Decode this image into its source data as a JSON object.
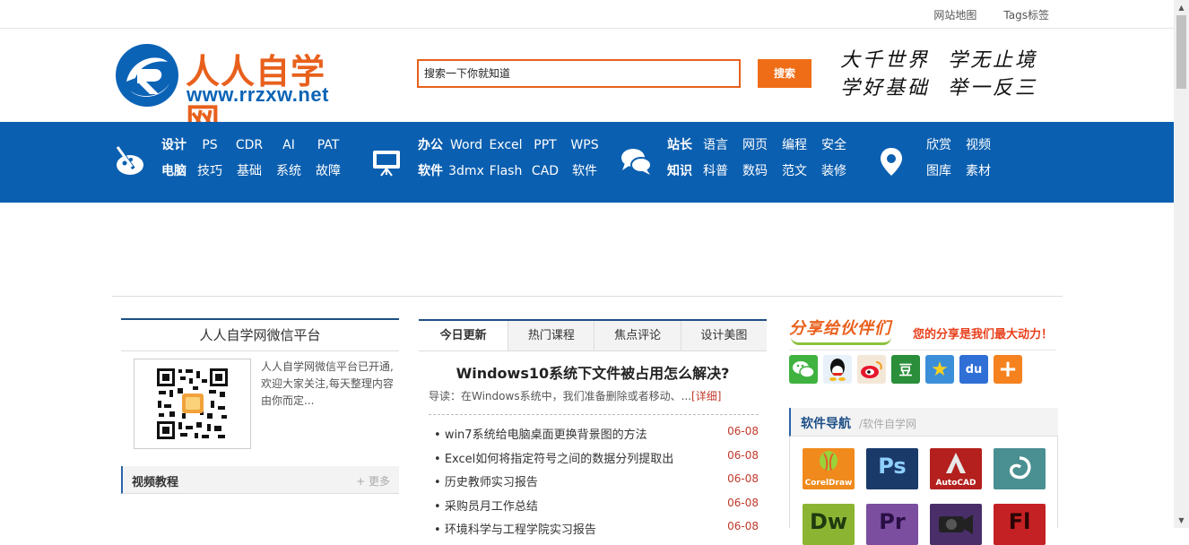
{
  "topbar": {
    "links": [
      "网站地图",
      "Tags标签"
    ]
  },
  "logo": {
    "name_cn": "人人自学网",
    "url": "www.rrzxw.net"
  },
  "search": {
    "value": "搜索一下你就知道",
    "button": "搜索"
  },
  "slogan": {
    "line1": [
      "大千世界",
      "学无止境"
    ],
    "line2": [
      "学好基础",
      "举一反三"
    ]
  },
  "nav": {
    "groups": [
      {
        "icon": "brush-palette-icon",
        "rows": [
          [
            "设计",
            "PS",
            "CDR",
            "AI",
            "PAT"
          ],
          [
            "电脑",
            "技巧",
            "基础",
            "系统",
            "故障"
          ]
        ]
      },
      {
        "icon": "presentation-screen-icon",
        "rows": [
          [
            "办公",
            "Word",
            "Excel",
            "PPT",
            "WPS"
          ],
          [
            "软件",
            "3dmx",
            "Flash",
            "CAD",
            "软件"
          ]
        ]
      },
      {
        "icon": "chat-bubbles-icon",
        "rows": [
          [
            "站长",
            "语言",
            "网页",
            "编程",
            "安全"
          ],
          [
            "知识",
            "科普",
            "数码",
            "范文",
            "装修"
          ]
        ]
      },
      {
        "icon": "location-pin-icon",
        "rows": [
          [
            "欣赏",
            "视频"
          ],
          [
            "图库",
            "素材"
          ]
        ]
      }
    ]
  },
  "wechat": {
    "title": "人人自学网微信平台",
    "text": "人人自学网微信平台已开通,欢迎大家关注,每天整理内容由你而定..."
  },
  "video": {
    "title": "视频教程",
    "more": "+ 更多"
  },
  "tabs": [
    "今日更新",
    "热门课程",
    "焦点评论",
    "设计美图"
  ],
  "headline": {
    "title": "Windows10系统下文件被占用怎么解决?",
    "summary": "导读：在Windows系统中，我们准备删除或者移动、...",
    "detail": "[详细]"
  },
  "news": [
    {
      "title": "win7系统给电脑桌面更换背景图的方法",
      "date": "06-08"
    },
    {
      "title": "Excel如何将指定符号之间的数据分列提取出",
      "date": "06-08"
    },
    {
      "title": "历史教师实习报告",
      "date": "06-08"
    },
    {
      "title": "采购员月工作总结",
      "date": "06-08"
    },
    {
      "title": "环境科学与工程学院实习报告",
      "date": "06-08"
    }
  ],
  "share": {
    "title": "分享给伙伴们",
    "motto": "您的分享是我们最大动力！",
    "icons": [
      {
        "name": "wechat-icon",
        "color": "#3fb23f",
        "glyph": ""
      },
      {
        "name": "qq-icon",
        "color": "#e8f1fa",
        "glyph": ""
      },
      {
        "name": "weibo-icon",
        "color": "#f3e7d8",
        "glyph": ""
      },
      {
        "name": "douban-icon",
        "color": "#2a8e3a",
        "glyph": "豆"
      },
      {
        "name": "qzone-icon",
        "color": "#3b8fd8",
        "glyph": "★"
      },
      {
        "name": "baidu-icon",
        "color": "#2f6fd6",
        "glyph": "du"
      },
      {
        "name": "more-share-icon",
        "color": "#f5821f",
        "glyph": "+"
      }
    ]
  },
  "software": {
    "title": "软件导航",
    "subtitle": "/软件自学网",
    "items": [
      {
        "name": "coreldraw-icon",
        "big": "",
        "label": "CorelDraw",
        "color": "#f08a1c"
      },
      {
        "name": "photoshop-icon",
        "big": "Ps",
        "label": "",
        "color": "#1a3a6a"
      },
      {
        "name": "autocad-icon",
        "big": "",
        "label": "AutoCAD",
        "color": "#b3201e"
      },
      {
        "name": "3dsmax-icon",
        "big": "",
        "label": "",
        "color": "#4a8f91"
      },
      {
        "name": "dreamweaver-icon",
        "big": "Dw",
        "label": "",
        "color": "#8bb433"
      },
      {
        "name": "premiere-icon",
        "big": "Pr",
        "label": "",
        "color": "#7b4ea0"
      },
      {
        "name": "camera-icon",
        "big": "",
        "label": "",
        "color": "#4a2e6a"
      },
      {
        "name": "flash-icon",
        "big": "Fl",
        "label": "",
        "color": "#c42124"
      }
    ]
  }
}
